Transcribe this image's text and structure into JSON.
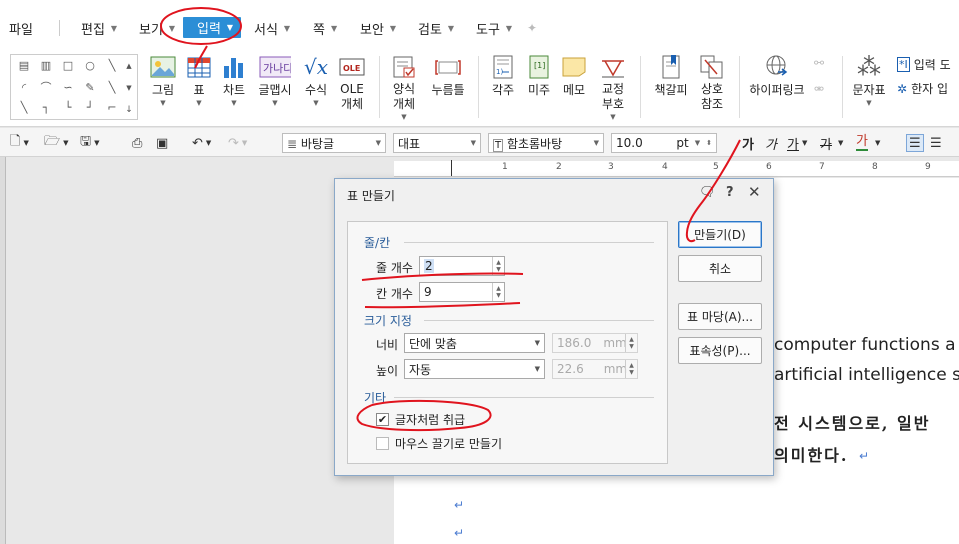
{
  "menubar": {
    "items": [
      {
        "label": "파일",
        "has_arrow": false
      },
      {
        "label": "편집",
        "has_arrow": true
      },
      {
        "label": "보기",
        "has_arrow": true
      },
      {
        "label": "입력",
        "has_arrow": true,
        "active": true
      },
      {
        "label": "서식",
        "has_arrow": true
      },
      {
        "label": "쪽",
        "has_arrow": true
      },
      {
        "label": "보안",
        "has_arrow": true
      },
      {
        "label": "검토",
        "has_arrow": true
      },
      {
        "label": "도구",
        "has_arrow": true
      }
    ],
    "accent_color": "#2b8ed6"
  },
  "ribbon": {
    "buttons": [
      {
        "label": "그림",
        "icon": "picture-icon"
      },
      {
        "label": "표",
        "icon": "table-icon"
      },
      {
        "label": "차트",
        "icon": "chart-icon"
      },
      {
        "label": "글맵시",
        "icon": "wordart-icon"
      },
      {
        "label": "수식",
        "icon": "equation-icon"
      },
      {
        "label": "OLE\n개체",
        "icon": "ole-icon"
      },
      {
        "label": "양식\n개체",
        "icon": "form-object-icon"
      },
      {
        "label": "누름틀",
        "icon": "field-icon"
      },
      {
        "label": "각주",
        "icon": "footnote-icon"
      },
      {
        "label": "미주",
        "icon": "endnote-icon"
      },
      {
        "label": "메모",
        "icon": "memo-icon"
      },
      {
        "label": "교정\n부호",
        "icon": "proofreading-mark-icon"
      },
      {
        "label": "책갈피",
        "icon": "bookmark-icon"
      },
      {
        "label": "상호\n참조",
        "icon": "cross-reference-icon"
      },
      {
        "label": "하이퍼링크",
        "icon": "hyperlink-icon"
      },
      {
        "label": "문자표",
        "icon": "symbol-icon"
      }
    ],
    "right_items": [
      "입력 도",
      "한자 입"
    ]
  },
  "toolbar": {
    "style": "바탕글",
    "lang": "대표",
    "font": "함초롬바탕",
    "size": "10.0",
    "unit": "pt",
    "styles": [
      "가",
      "가",
      "가",
      "가",
      "가"
    ]
  },
  "ruler": {
    "numbers": [
      "1",
      "2",
      "3",
      "4",
      "5",
      "6",
      "7",
      "8",
      "9"
    ]
  },
  "document": {
    "lines": [
      "computer functions a",
      "artificial intelligence s",
      "전 시스템으로, 일반",
      "의미한다."
    ],
    "para_mark": "↵"
  },
  "dialog": {
    "title": "표 만들기",
    "group_rows_cols": "줄/칸",
    "rows_label": "줄 개수",
    "rows_value": "2",
    "cols_label": "칸 개수",
    "cols_value": "9",
    "group_size": "크기 지정",
    "width_label": "너비",
    "width_mode": "단에 맞춤",
    "width_value": "186.0",
    "width_unit": "mm",
    "height_label": "높이",
    "height_mode": "자동",
    "height_value": "22.6",
    "height_unit": "mm",
    "group_etc": "기타",
    "treat_as_char": "글자처럼 취급",
    "treat_as_char_checked": true,
    "mouse_drag": "마우스 끌기로 만들기",
    "mouse_drag_checked": false,
    "btn_create": "만들기(D)",
    "btn_cancel": "취소",
    "btn_table_wizard": "표 마당(A)...",
    "btn_properties": "표속성(P)..."
  },
  "annotation_color": "#e0141e"
}
